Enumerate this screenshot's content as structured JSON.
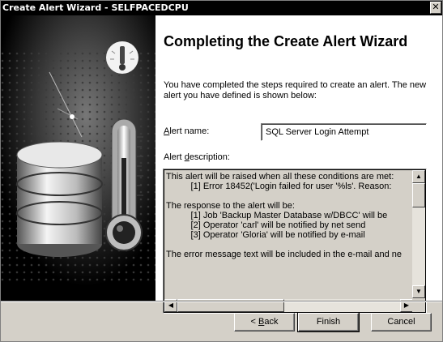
{
  "window": {
    "title": "Create Alert Wizard - SELFPACEDCPU",
    "close_symbol": "✕"
  },
  "page": {
    "heading": "Completing the Create Alert Wizard",
    "intro": "You have completed the steps required to create an alert.  The new alert you have defined is shown below:"
  },
  "alert_name": {
    "label_pre": "",
    "label_access": "A",
    "label_post": "lert name:",
    "value": "SQL Server Login Attempt"
  },
  "alert_description": {
    "label_pre": "Alert ",
    "label_access": "d",
    "label_post": "escription:",
    "lines": [
      "This alert will be raised when all these conditions are met:",
      "          [1] Error 18452('Login failed for user '%ls'. Reason:",
      "",
      "The response to the alert will be:",
      "          [1] Job 'Backup Master Database w/DBCC' will be",
      "          [2] Operator 'carl' will be notified by net send",
      "          [3] Operator 'Gloria' will be notified by e-mail",
      "",
      "The error message text will be included in the e-mail and ne"
    ]
  },
  "buttons": {
    "back": {
      "pre": "< ",
      "access": "B",
      "post": "ack"
    },
    "finish": "Finish",
    "cancel": "Cancel"
  },
  "icons": {
    "sidebar": "database-thermometer-illustration",
    "wizard": "wizard-badge-icon"
  }
}
